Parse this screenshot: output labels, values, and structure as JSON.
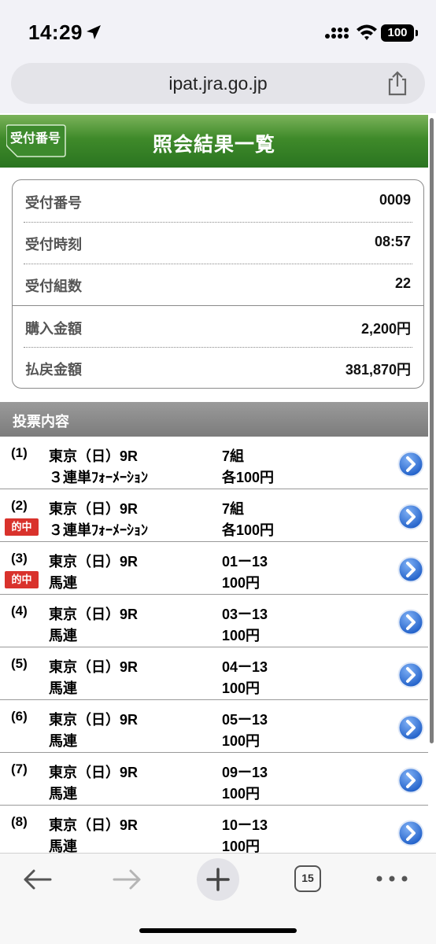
{
  "status_bar": {
    "time": "14:29",
    "battery": "100"
  },
  "browser": {
    "url": "ipat.jra.go.jp",
    "tab_count": "15"
  },
  "header": {
    "back_label": "受付番号",
    "title": "照会結果一覧"
  },
  "summary": {
    "rows": [
      {
        "label": "受付番号",
        "value": "0009"
      },
      {
        "label": "受付時刻",
        "value": "08:57"
      },
      {
        "label": "受付組数",
        "value": "22"
      },
      {
        "label": "購入金額",
        "value": "2,200円"
      },
      {
        "label": "払戻金額",
        "value": "381,870円"
      }
    ]
  },
  "section_title": "投票内容",
  "hit_label": "的中",
  "items": [
    {
      "num": "(1)",
      "race": "東京（日）9R",
      "bet_type": "３連単ﾌｫｰﾒｰｼｮﾝ",
      "combination": "7組",
      "amount": "各100円",
      "hit": false
    },
    {
      "num": "(2)",
      "race": "東京（日）9R",
      "bet_type": "３連単ﾌｫｰﾒｰｼｮﾝ",
      "combination": "7組",
      "amount": "各100円",
      "hit": true
    },
    {
      "num": "(3)",
      "race": "東京（日）9R",
      "bet_type": "馬連",
      "combination": "01ー13",
      "amount": "100円",
      "hit": true
    },
    {
      "num": "(4)",
      "race": "東京（日）9R",
      "bet_type": "馬連",
      "combination": "03ー13",
      "amount": "100円",
      "hit": false
    },
    {
      "num": "(5)",
      "race": "東京（日）9R",
      "bet_type": "馬連",
      "combination": "04ー13",
      "amount": "100円",
      "hit": false
    },
    {
      "num": "(6)",
      "race": "東京（日）9R",
      "bet_type": "馬連",
      "combination": "05ー13",
      "amount": "100円",
      "hit": false
    },
    {
      "num": "(7)",
      "race": "東京（日）9R",
      "bet_type": "馬連",
      "combination": "09ー13",
      "amount": "100円",
      "hit": false
    },
    {
      "num": "(8)",
      "race": "東京（日）9R",
      "bet_type": "馬連",
      "combination": "10ー13",
      "amount": "100円",
      "hit": false
    }
  ],
  "colors": {
    "header_green": "#3f8a2a",
    "hit_red": "#d9322c",
    "go_blue": "#2f6fd6"
  }
}
